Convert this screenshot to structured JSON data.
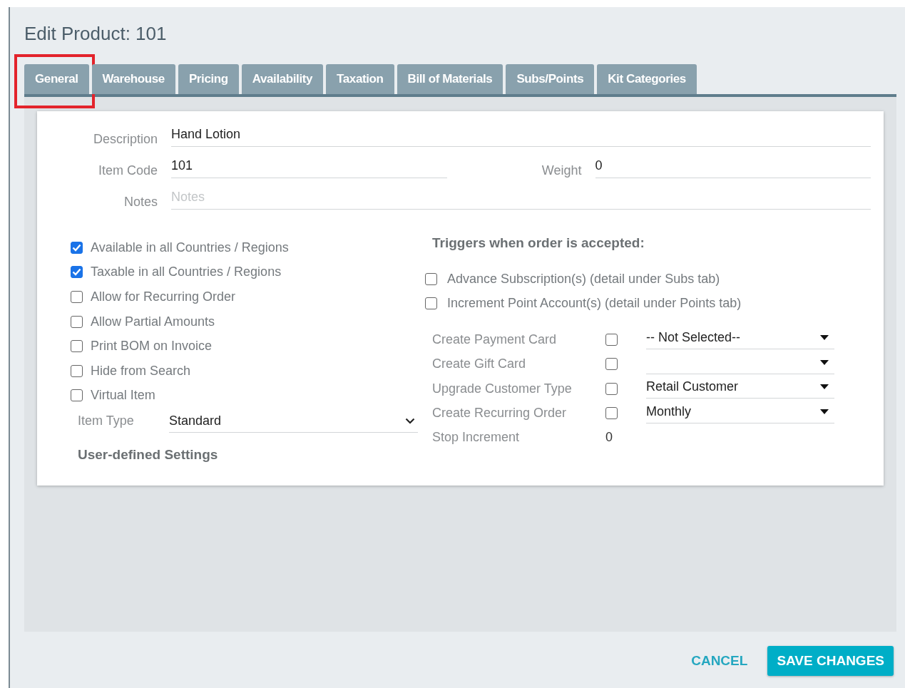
{
  "title": "Edit Product: 101",
  "tabs": [
    {
      "label": "General",
      "highlighted": true
    },
    {
      "label": "Warehouse",
      "highlighted": false
    },
    {
      "label": "Pricing",
      "highlighted": false
    },
    {
      "label": "Availability",
      "highlighted": false
    },
    {
      "label": "Taxation",
      "highlighted": false
    },
    {
      "label": "Bill of Materials",
      "highlighted": false
    },
    {
      "label": "Subs/Points",
      "highlighted": false
    },
    {
      "label": "Kit Categories",
      "highlighted": false
    }
  ],
  "fields": {
    "description": {
      "label": "Description",
      "value": "Hand Lotion"
    },
    "item_code": {
      "label": "Item Code",
      "value": "101"
    },
    "weight": {
      "label": "Weight",
      "value": "0"
    },
    "notes": {
      "label": "Notes",
      "placeholder": "Notes"
    }
  },
  "options": [
    {
      "label": "Available in all Countries / Regions",
      "checked": true
    },
    {
      "label": "Taxable in all Countries / Regions",
      "checked": true
    },
    {
      "label": "Allow for Recurring Order",
      "checked": false
    },
    {
      "label": "Allow Partial Amounts",
      "checked": false
    },
    {
      "label": "Print BOM on Invoice",
      "checked": false
    },
    {
      "label": "Hide from Search",
      "checked": false
    },
    {
      "label": "Virtual Item",
      "checked": false
    }
  ],
  "item_type": {
    "label": "Item Type",
    "value": "Standard"
  },
  "user_defined_heading": "User-defined Settings",
  "triggers": {
    "heading": "Triggers when order is accepted:",
    "checks": [
      {
        "label": "Advance Subscription(s) (detail under Subs tab)",
        "checked": false
      },
      {
        "label": "Increment Point Account(s) (detail under Points tab)",
        "checked": false
      }
    ],
    "rows": [
      {
        "kind": "select",
        "label": "Create Payment Card",
        "checked": false,
        "value": "-- Not Selected--"
      },
      {
        "kind": "select",
        "label": "Create Gift Card",
        "checked": false
      },
      {
        "kind": "select",
        "label": "Upgrade Customer Type",
        "checked": false,
        "value": "Retail Customer"
      },
      {
        "kind": "select",
        "label": "Create Recurring Order",
        "checked": false,
        "value": "Monthly"
      },
      {
        "kind": "value",
        "label": "Stop Increment",
        "value": "0"
      }
    ]
  },
  "buttons": {
    "cancel": "CANCEL",
    "save": "SAVE CHANGES"
  }
}
